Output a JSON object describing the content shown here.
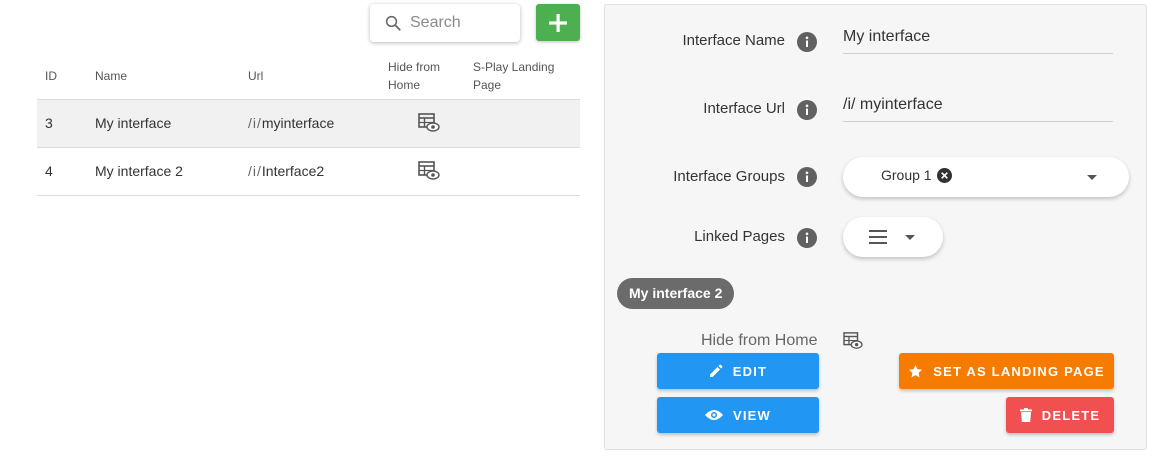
{
  "search": {
    "placeholder": "Search"
  },
  "table": {
    "headers": {
      "id": "ID",
      "name": "Name",
      "url": "Url",
      "hide_line1": "Hide from",
      "hide_line2": "Home",
      "landing_line1": "S-Play Landing",
      "landing_line2": "Page"
    },
    "rows": [
      {
        "id": "3",
        "name": "My interface",
        "url_prefix": "/i/",
        "url_slug": "myinterface"
      },
      {
        "id": "4",
        "name": "My interface 2",
        "url_prefix": "/i/",
        "url_slug": "Interface2"
      }
    ]
  },
  "form": {
    "name_label": "Interface Name",
    "name_value": "My interface",
    "url_label": "Interface Url",
    "url_value": "/i/ myinterface",
    "groups_label": "Interface Groups",
    "group_chip": "Group 1",
    "linked_label": "Linked Pages",
    "linked_chip": "My interface 2",
    "hide_label": "Hide from Home"
  },
  "buttons": {
    "edit": "EDIT",
    "view": "VIEW",
    "landing": "SET AS LANDING PAGE",
    "delete": "DELETE"
  },
  "icons": {
    "search": "search-icon",
    "add": "plus-icon",
    "hide_home": "table-eye-icon",
    "info": "info-icon",
    "clear": "close-circle-icon",
    "menu": "menu-icon",
    "edit": "pencil-icon",
    "view": "eye-icon",
    "landing": "star-icon",
    "delete": "trash-icon"
  },
  "colors": {
    "add_button": "#4caf50",
    "primary": "#2196f3",
    "landing": "#f57c00",
    "danger": "#f05050",
    "chip": "#6b6b6b",
    "selected_row": "#f1f1f1"
  }
}
